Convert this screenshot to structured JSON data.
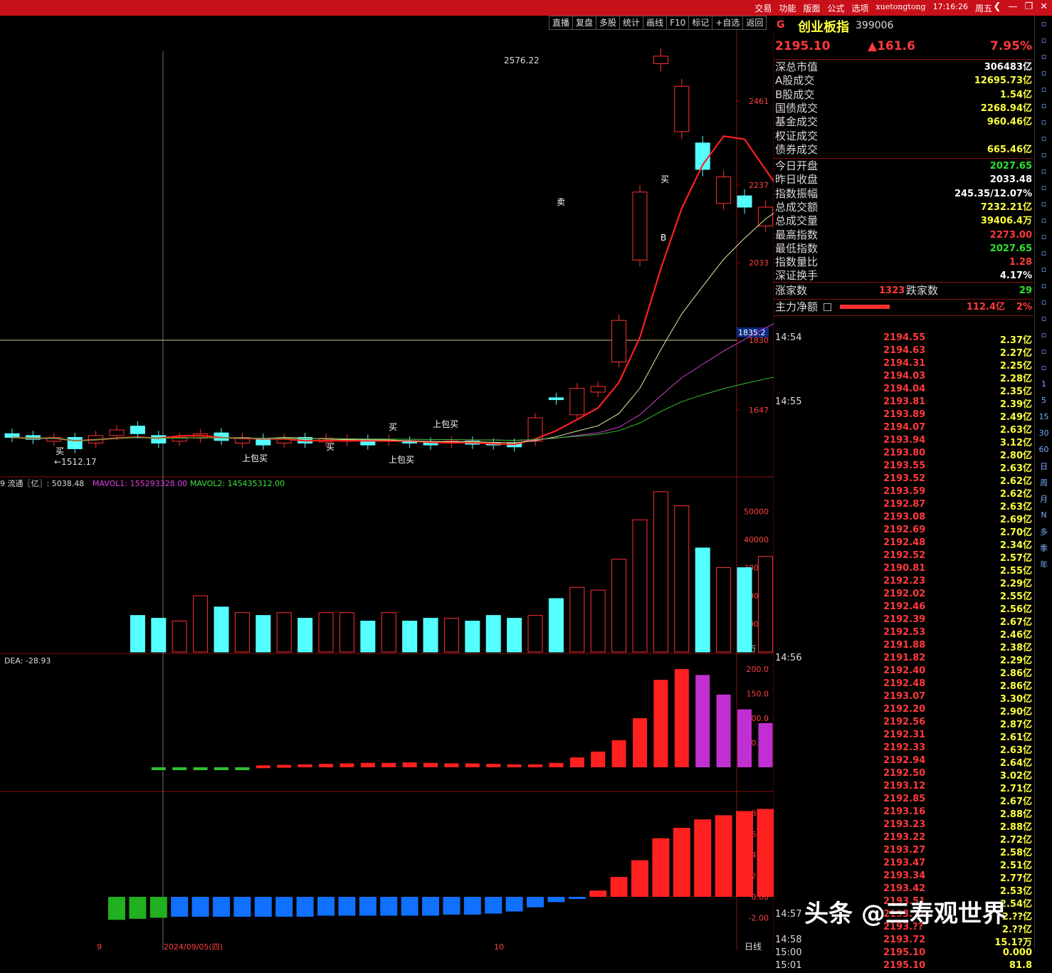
{
  "topbar": {
    "menu": [
      "交易",
      "功能",
      "版面",
      "公式",
      "选项"
    ],
    "user": "xuetongtong",
    "time": "17:16:26",
    "weekday": "周五"
  },
  "toolbar": [
    "直播",
    "复盘",
    "多股",
    "统计",
    "画线",
    "F10",
    "标记",
    "+自选",
    "返回"
  ],
  "quote": {
    "flag": "G",
    "name": "创业板指",
    "code": "399006",
    "price": "2195.10",
    "change": "▲161.6",
    "pct": "7.95%"
  },
  "stats": [
    {
      "label": "深总市值",
      "value": "306483亿",
      "color": "#ffffff"
    },
    {
      "label": "A股成交",
      "value": "12695.73亿",
      "color": "#ffff40"
    },
    {
      "label": "B股成交",
      "value": "1.54亿",
      "color": "#ffff40"
    },
    {
      "label": "国债成交",
      "value": "2268.94亿",
      "color": "#ffff40"
    },
    {
      "label": "基金成交",
      "value": "960.46亿",
      "color": "#ffff40"
    },
    {
      "label": "权证成交",
      "value": "",
      "color": "#ffff40"
    },
    {
      "label": "债券成交",
      "value": "665.46亿",
      "color": "#ffff40"
    }
  ],
  "stats2": [
    {
      "label": "今日开盘",
      "value": "2027.65",
      "color": "#30e030"
    },
    {
      "label": "昨日收盘",
      "value": "2033.48",
      "color": "#ffffff"
    },
    {
      "label": "指数振幅",
      "value": "245.35/12.07%",
      "color": "#ffffff"
    },
    {
      "label": "总成交额",
      "value": "7232.21亿",
      "color": "#ffff40"
    },
    {
      "label": "总成交量",
      "value": "39406.4万",
      "color": "#ffff40"
    },
    {
      "label": "最高指数",
      "value": "2273.00",
      "color": "#ff3a3a"
    },
    {
      "label": "最低指数",
      "value": "2027.65",
      "color": "#30e030"
    },
    {
      "label": "指数量比",
      "value": "1.28",
      "color": "#ff3a3a"
    },
    {
      "label": "深证换手",
      "value": "4.17%",
      "color": "#ffffff"
    }
  ],
  "breadth": {
    "up_label": "涨家数",
    "up": "1323",
    "down_label": "跌家数",
    "down": "29"
  },
  "mainflow": {
    "label": "主力净额",
    "amount": "112.4亿",
    "pct": "2%"
  },
  "ticks": [
    {
      "t": "14:54",
      "p": "2194.55",
      "v": "2.37亿"
    },
    {
      "t": "",
      "p": "2194.63",
      "v": "2.27亿"
    },
    {
      "t": "",
      "p": "2194.31",
      "v": "2.25亿"
    },
    {
      "t": "",
      "p": "2194.03",
      "v": "2.28亿"
    },
    {
      "t": "",
      "p": "2194.04",
      "v": "2.35亿"
    },
    {
      "t": "14:55",
      "p": "2193.81",
      "v": "2.39亿"
    },
    {
      "t": "",
      "p": "2193.89",
      "v": "2.49亿"
    },
    {
      "t": "",
      "p": "2194.07",
      "v": "2.63亿"
    },
    {
      "t": "",
      "p": "2193.94",
      "v": "3.12亿"
    },
    {
      "t": "",
      "p": "2193.80",
      "v": "2.80亿"
    },
    {
      "t": "",
      "p": "2193.55",
      "v": "2.63亿"
    },
    {
      "t": "",
      "p": "2193.52",
      "v": "2.62亿"
    },
    {
      "t": "",
      "p": "2193.59",
      "v": "2.62亿"
    },
    {
      "t": "",
      "p": "2192.87",
      "v": "2.63亿"
    },
    {
      "t": "",
      "p": "2193.08",
      "v": "2.69亿"
    },
    {
      "t": "",
      "p": "2192.69",
      "v": "2.70亿"
    },
    {
      "t": "",
      "p": "2192.48",
      "v": "2.34亿"
    },
    {
      "t": "",
      "p": "2192.52",
      "v": "2.57亿"
    },
    {
      "t": "",
      "p": "2190.81",
      "v": "2.55亿"
    },
    {
      "t": "",
      "p": "2192.23",
      "v": "2.29亿"
    },
    {
      "t": "",
      "p": "2192.02",
      "v": "2.55亿"
    },
    {
      "t": "",
      "p": "2192.46",
      "v": "2.56亿"
    },
    {
      "t": "",
      "p": "2192.39",
      "v": "2.67亿"
    },
    {
      "t": "",
      "p": "2192.53",
      "v": "2.46亿"
    },
    {
      "t": "",
      "p": "2191.88",
      "v": "2.38亿"
    },
    {
      "t": "14:56",
      "p": "2191.82",
      "v": "2.29亿"
    },
    {
      "t": "",
      "p": "2192.40",
      "v": "2.86亿"
    },
    {
      "t": "",
      "p": "2192.48",
      "v": "2.86亿"
    },
    {
      "t": "",
      "p": "2193.07",
      "v": "3.30亿"
    },
    {
      "t": "",
      "p": "2192.20",
      "v": "2.90亿"
    },
    {
      "t": "",
      "p": "2192.56",
      "v": "2.87亿"
    },
    {
      "t": "",
      "p": "2192.31",
      "v": "2.61亿"
    },
    {
      "t": "",
      "p": "2192.33",
      "v": "2.63亿"
    },
    {
      "t": "",
      "p": "2192.94",
      "v": "2.64亿"
    },
    {
      "t": "",
      "p": "2192.50",
      "v": "3.02亿"
    },
    {
      "t": "",
      "p": "2193.12",
      "v": "2.71亿"
    },
    {
      "t": "",
      "p": "2192.85",
      "v": "2.67亿"
    },
    {
      "t": "",
      "p": "2193.16",
      "v": "2.88亿"
    },
    {
      "t": "",
      "p": "2193.23",
      "v": "2.88亿"
    },
    {
      "t": "",
      "p": "2193.22",
      "v": "2.72亿"
    },
    {
      "t": "",
      "p": "2193.27",
      "v": "2.58亿"
    },
    {
      "t": "",
      "p": "2193.47",
      "v": "2.51亿"
    },
    {
      "t": "",
      "p": "2193.34",
      "v": "2.77亿"
    },
    {
      "t": "",
      "p": "2193.42",
      "v": "2.53亿"
    },
    {
      "t": "",
      "p": "2193.51",
      "v": "2.54亿"
    },
    {
      "t": "14:57",
      "p": "2193.71",
      "v": "2.??亿"
    },
    {
      "t": "",
      "p": "2193.??",
      "v": "2.??亿"
    },
    {
      "t": "14:58",
      "p": "2193.72",
      "v": "15.1?万"
    },
    {
      "t": "15:00",
      "p": "2195.10",
      "v": "0.000"
    },
    {
      "t": "15:01",
      "p": "2195.10",
      "v": "81.8"
    }
  ],
  "chart": {
    "price_ticks": [
      "2461",
      "2237",
      "2033",
      "1830",
      "1647"
    ],
    "cursor_price": "1835.2",
    "high_label": "2576.22",
    "low_label": "←1512.17",
    "signals": [
      "买",
      "上包买",
      "上包买",
      "买",
      "上包买",
      "买",
      "卖",
      "B",
      "买"
    ],
    "vol_legend": {
      "a": "9 流通〖亿〗: 5038.48",
      "b": "MAVOL1: 155293328.00",
      "c": "MAVOL2: 145435312.00"
    },
    "vol_ticks": [
      "50000",
      "40000",
      "30000",
      "20000",
      "10000"
    ],
    "vol_unit": "X1万",
    "macd_legend": "DEA: -28.93",
    "macd_ticks": [
      "200.0",
      "150.0",
      "100.0",
      "50.00"
    ],
    "ind_ticks": [
      "8.00",
      "6.00",
      "4.00",
      "2.00",
      "0.00",
      "-2.00"
    ],
    "date_labels": [
      "9",
      "2024/09/05(四)",
      "10",
      "日线"
    ]
  },
  "candles": [
    {
      "o": 1580,
      "c": 1570
    },
    {
      "o": 1575,
      "c": 1565
    },
    {
      "o": 1560,
      "c": 1570
    },
    {
      "o": 1570,
      "c": 1540
    },
    {
      "o": 1555,
      "c": 1575
    },
    {
      "o": 1575,
      "c": 1590
    },
    {
      "o": 1600,
      "c": 1580
    },
    {
      "o": 1575,
      "c": 1555
    },
    {
      "o": 1560,
      "c": 1570
    },
    {
      "o": 1568,
      "c": 1580
    },
    {
      "o": 1582,
      "c": 1562
    },
    {
      "o": 1555,
      "c": 1570
    },
    {
      "o": 1568,
      "c": 1550
    },
    {
      "o": 1555,
      "c": 1568
    },
    {
      "o": 1570,
      "c": 1555
    },
    {
      "o": 1558,
      "c": 1568
    },
    {
      "o": 1560,
      "c": 1565
    },
    {
      "o": 1565,
      "c": 1550
    },
    {
      "o": 1560,
      "c": 1565
    },
    {
      "o": 1560,
      "c": 1555
    },
    {
      "o": 1558,
      "c": 1550
    },
    {
      "o": 1555,
      "c": 1560
    },
    {
      "o": 1560,
      "c": 1552
    },
    {
      "o": 1555,
      "c": 1550
    },
    {
      "o": 1555,
      "c": 1545
    },
    {
      "o": 1560,
      "c": 1622
    },
    {
      "o": 1675,
      "c": 1670
    },
    {
      "o": 1630,
      "c": 1700
    },
    {
      "o": 1690,
      "c": 1705
    },
    {
      "o": 1770,
      "c": 1880
    },
    {
      "o": 2040,
      "c": 2220
    },
    {
      "o": 2560,
      "c": 2580
    },
    {
      "o": 2380,
      "c": 2500
    },
    {
      "o": 2350,
      "c": 2280
    },
    {
      "o": 2190,
      "c": 2260
    },
    {
      "o": 2210,
      "c": 2180
    },
    {
      "o": 2130,
      "c": 2180
    },
    {
      "o": 2090,
      "c": 2095
    },
    {
      "o": 2095,
      "c": 2120
    },
    {
      "o": 2033,
      "c": 2195
    }
  ],
  "volumes": [
    13,
    12,
    11,
    20,
    16,
    14,
    13,
    14,
    12,
    14,
    14,
    11,
    14,
    11,
    12,
    12,
    11,
    13,
    12,
    13,
    19,
    23,
    22,
    33,
    47,
    57,
    52,
    37,
    30,
    30,
    34,
    28,
    31,
    39
  ],
  "macd": [
    -5,
    -5,
    -4,
    -4,
    -3,
    4,
    5,
    6,
    7,
    8,
    9,
    9,
    10,
    9,
    8,
    8,
    7,
    6,
    6,
    9,
    20,
    32,
    55,
    100,
    178,
    200,
    188,
    148,
    118,
    90,
    55,
    25,
    18
  ],
  "indicator": [
    -2.2,
    -2.1,
    -2.0,
    -1.9,
    -1.9,
    -1.9,
    -1.9,
    -1.9,
    -1.9,
    -1.9,
    -1.8,
    -1.8,
    -1.8,
    -1.8,
    -1.8,
    -1.8,
    -1.7,
    -1.7,
    -1.6,
    -1.4,
    -1.0,
    -0.5,
    -0.2,
    0.6,
    1.9,
    3.5,
    5.6,
    6.6,
    7.4,
    7.8,
    8.2,
    8.4,
    8.5,
    8.6,
    8.7
  ]
}
